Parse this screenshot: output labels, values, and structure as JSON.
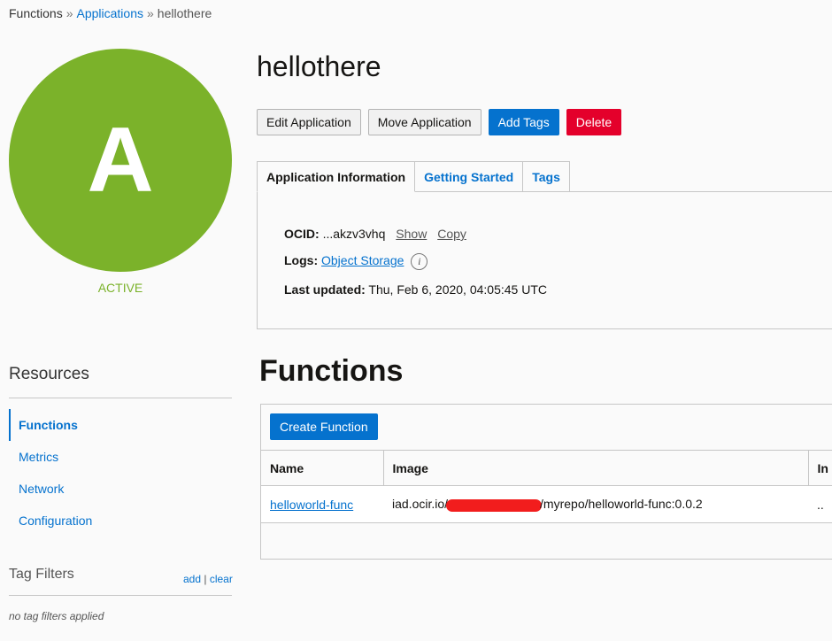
{
  "breadcrumb": {
    "root": "Functions",
    "separator1": "»",
    "applications": "Applications",
    "separator2": "»",
    "current": "hellothere"
  },
  "app": {
    "initial": "A",
    "status": "ACTIVE",
    "name": "hellothere",
    "avatar_color": "#7bb22a"
  },
  "actions": {
    "edit": "Edit Application",
    "move": "Move Application",
    "add_tags": "Add Tags",
    "delete": "Delete"
  },
  "tabs": [
    {
      "label": "Application Information",
      "active": true
    },
    {
      "label": "Getting Started",
      "active": false
    },
    {
      "label": "Tags",
      "active": false
    }
  ],
  "info": {
    "ocid_label": "OCID:",
    "ocid_value": "...akzv3vhq",
    "show": "Show",
    "copy": "Copy",
    "logs_label": "Logs:",
    "logs_value": "Object Storage",
    "info_glyph": "i",
    "updated_label": "Last updated:",
    "updated_value": "Thu, Feb 6, 2020, 04:05:45 UTC"
  },
  "resources": {
    "title": "Resources",
    "items": [
      {
        "label": "Functions",
        "active": true
      },
      {
        "label": "Metrics",
        "active": false
      },
      {
        "label": "Network",
        "active": false
      },
      {
        "label": "Configuration",
        "active": false
      }
    ]
  },
  "tag_filters": {
    "title": "Tag Filters",
    "add": "add",
    "divider": "|",
    "clear": "clear",
    "empty": "no tag filters applied"
  },
  "functions": {
    "title": "Functions",
    "create_button": "Create Function",
    "columns": [
      "Name",
      "Image",
      "In"
    ],
    "rows": [
      {
        "name": "helloworld-func",
        "image_prefix": "iad.ocir.io/",
        "image_suffix": "/myrepo/helloworld-func:0.0.2",
        "extra": ".."
      }
    ]
  },
  "colors": {
    "accent": "#0572ce",
    "danger": "#e4002b",
    "active_green": "#7bb22a"
  }
}
